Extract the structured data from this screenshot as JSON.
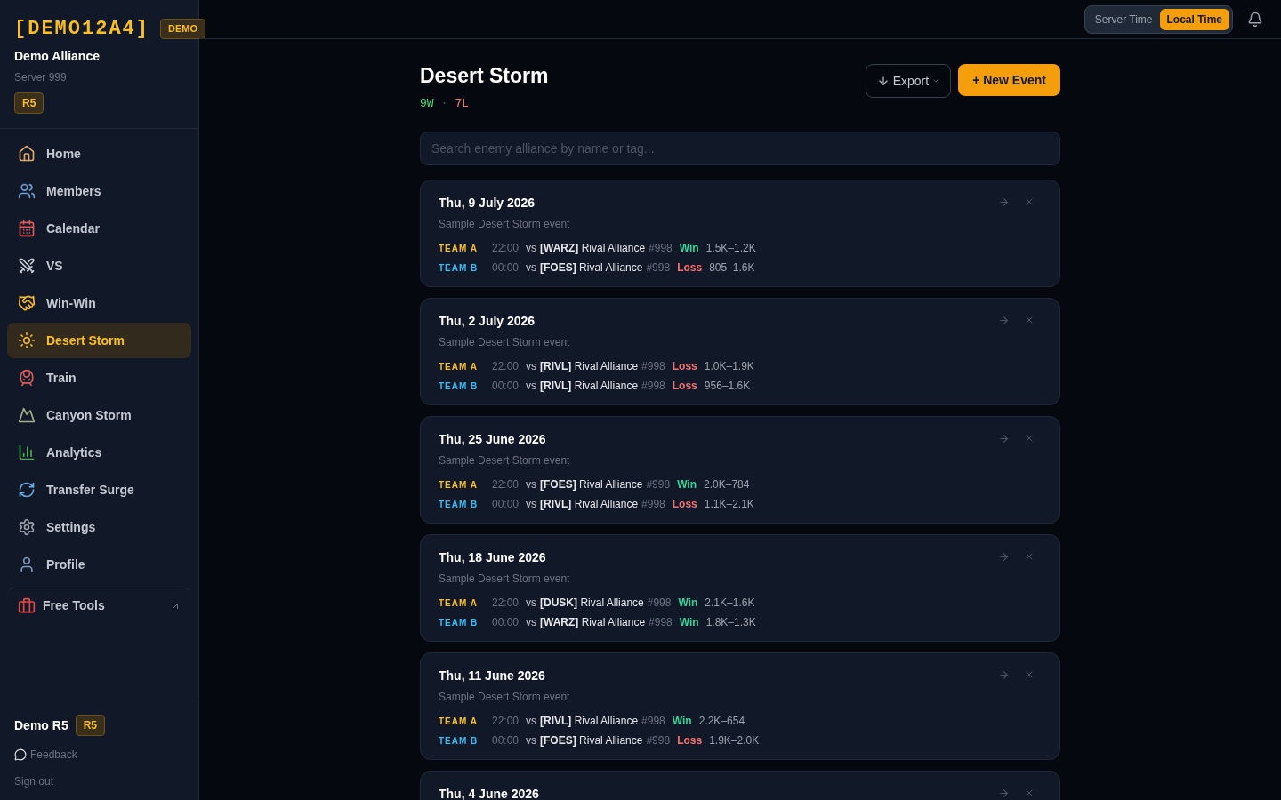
{
  "sidebar": {
    "tag": "[DEMO12A4]",
    "demo_badge": "DEMO",
    "alliance": "Demo Alliance",
    "server": "Server 999",
    "rank": "R5",
    "nav": [
      {
        "label": "Home",
        "kind": "home",
        "selected": false
      },
      {
        "label": "Members",
        "kind": "members",
        "selected": false
      },
      {
        "label": "Calendar",
        "kind": "calendar",
        "selected": false
      },
      {
        "label": "VS",
        "kind": "swords",
        "selected": false
      },
      {
        "label": "Win-Win",
        "kind": "handshake",
        "selected": false
      },
      {
        "label": "Desert Storm",
        "kind": "desert",
        "selected": true
      },
      {
        "label": "Train",
        "kind": "train",
        "selected": false
      },
      {
        "label": "Canyon Storm",
        "kind": "mountain",
        "selected": false
      },
      {
        "label": "Analytics",
        "kind": "chart",
        "selected": false
      },
      {
        "label": "Transfer Surge",
        "kind": "refresh",
        "selected": false
      },
      {
        "label": "Settings",
        "kind": "settings",
        "selected": false
      },
      {
        "label": "Profile",
        "kind": "profile",
        "selected": false
      }
    ],
    "free_tools": "Free Tools",
    "user": {
      "name": "Demo R5",
      "rank": "R5"
    },
    "feedback": "Feedback",
    "sign_out": "Sign out"
  },
  "topbar": {
    "time_modes": [
      {
        "label": "Server Time",
        "selected": false
      },
      {
        "label": "Local Time",
        "selected": true
      }
    ]
  },
  "page": {
    "title": "Desert Storm",
    "wins": "9W",
    "separator": "·",
    "losses": "7L",
    "export": "Export",
    "new_event": "+ New Event",
    "search": {
      "placeholder": "Search enemy alliance by name or tag..."
    },
    "events": [
      {
        "date": "Thu, 9 July 2026",
        "subtitle": "Sample Desert Storm event",
        "matches": [
          {
            "team": "TEAM A",
            "kind": "a",
            "time": "22:00",
            "vs": "vs",
            "tag": "[WARZ]",
            "name": "Rival Alliance",
            "server": "#998",
            "result": "Win",
            "won": true,
            "score": "1.5K–1.2K"
          },
          {
            "team": "TEAM B",
            "kind": "b",
            "time": "00:00",
            "vs": "vs",
            "tag": "[FOES]",
            "name": "Rival Alliance",
            "server": "#998",
            "result": "Loss",
            "won": false,
            "score": "805–1.6K"
          }
        ]
      },
      {
        "date": "Thu, 2 July 2026",
        "subtitle": "Sample Desert Storm event",
        "matches": [
          {
            "team": "TEAM A",
            "kind": "a",
            "time": "22:00",
            "vs": "vs",
            "tag": "[RIVL]",
            "name": "Rival Alliance",
            "server": "#998",
            "result": "Loss",
            "won": false,
            "score": "1.0K–1.9K"
          },
          {
            "team": "TEAM B",
            "kind": "b",
            "time": "00:00",
            "vs": "vs",
            "tag": "[RIVL]",
            "name": "Rival Alliance",
            "server": "#998",
            "result": "Loss",
            "won": false,
            "score": "956–1.6K"
          }
        ]
      },
      {
        "date": "Thu, 25 June 2026",
        "subtitle": "Sample Desert Storm event",
        "matches": [
          {
            "team": "TEAM A",
            "kind": "a",
            "time": "22:00",
            "vs": "vs",
            "tag": "[FOES]",
            "name": "Rival Alliance",
            "server": "#998",
            "result": "Win",
            "won": true,
            "score": "2.0K–784"
          },
          {
            "team": "TEAM B",
            "kind": "b",
            "time": "00:00",
            "vs": "vs",
            "tag": "[RIVL]",
            "name": "Rival Alliance",
            "server": "#998",
            "result": "Loss",
            "won": false,
            "score": "1.1K–2.1K"
          }
        ]
      },
      {
        "date": "Thu, 18 June 2026",
        "subtitle": "Sample Desert Storm event",
        "matches": [
          {
            "team": "TEAM A",
            "kind": "a",
            "time": "22:00",
            "vs": "vs",
            "tag": "[DUSK]",
            "name": "Rival Alliance",
            "server": "#998",
            "result": "Win",
            "won": true,
            "score": "2.1K–1.6K"
          },
          {
            "team": "TEAM B",
            "kind": "b",
            "time": "00:00",
            "vs": "vs",
            "tag": "[WARZ]",
            "name": "Rival Alliance",
            "server": "#998",
            "result": "Win",
            "won": true,
            "score": "1.8K–1.3K"
          }
        ]
      },
      {
        "date": "Thu, 11 June 2026",
        "subtitle": "Sample Desert Storm event",
        "matches": [
          {
            "team": "TEAM A",
            "kind": "a",
            "time": "22:00",
            "vs": "vs",
            "tag": "[RIVL]",
            "name": "Rival Alliance",
            "server": "#998",
            "result": "Win",
            "won": true,
            "score": "2.2K–654"
          },
          {
            "team": "TEAM B",
            "kind": "b",
            "time": "00:00",
            "vs": "vs",
            "tag": "[FOES]",
            "name": "Rival Alliance",
            "server": "#998",
            "result": "Loss",
            "won": false,
            "score": "1.9K–2.0K"
          }
        ]
      },
      {
        "date": "Thu, 4 June 2026"
      }
    ]
  }
}
